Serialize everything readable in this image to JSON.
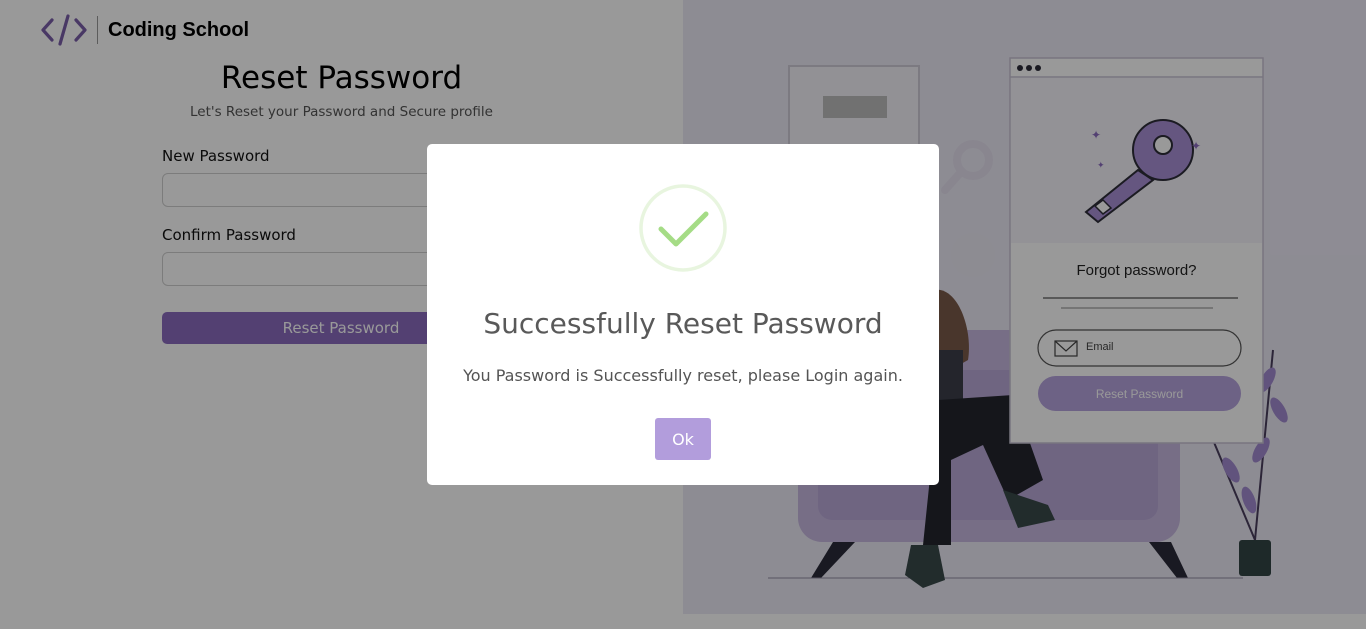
{
  "brand": {
    "name": "Coding School",
    "logo_icon": "code-brackets-icon"
  },
  "form": {
    "title": "Reset Password",
    "subtitle": "Let's Reset your Password and Secure profile",
    "new_password_label": "New Password",
    "new_password_value": "",
    "confirm_password_label": "Confirm Password",
    "confirm_password_value": "",
    "submit_label": "Reset Password"
  },
  "illustration": {
    "heading": "Forgot password?",
    "email_placeholder": "Email",
    "button_label": "Reset Password",
    "icons": [
      "key-icon",
      "mail-icon",
      "browser-dots-icon"
    ]
  },
  "modal": {
    "icon": "success-check-icon",
    "title": "Successfully Reset Password",
    "message": "You Password is Successfully reset, please Login again.",
    "ok_label": "Ok"
  },
  "colors": {
    "brand_purple": "#8a6bbf",
    "ok_button": "#b29ddc",
    "success_green": "#a5dc86",
    "overlay": "rgba(0,0,0,0.4)"
  }
}
